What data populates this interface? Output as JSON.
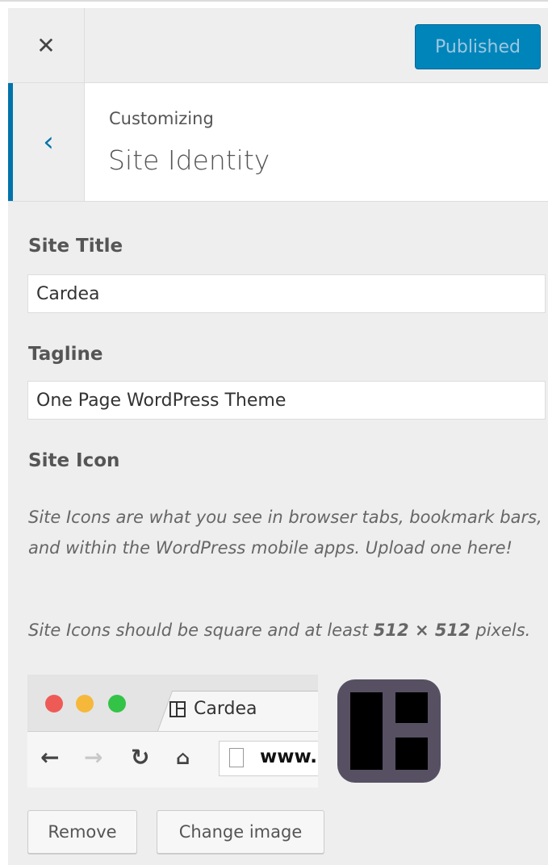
{
  "header": {
    "close_label": "✕",
    "publish_label": "Published"
  },
  "section": {
    "back_label": "‹",
    "subtitle": "Customizing",
    "title": "Site Identity"
  },
  "fields": {
    "site_title_label": "Site Title",
    "site_title_value": "Cardea",
    "tagline_label": "Tagline",
    "tagline_value": "One Page WordPress Theme"
  },
  "site_icon": {
    "label": "Site Icon",
    "description": "Site Icons are what you see in browser tabs, bookmark bars, and within the WordPress mobile apps. Upload one here!",
    "size_note_prefix": "Site Icons should be square and at least ",
    "size_note_value": "512 × 512",
    "size_note_suffix": " pixels.",
    "preview_tab_title": "Cardea",
    "preview_url": "www.",
    "remove_label": "Remove",
    "change_label": "Change image"
  },
  "colors": {
    "accent": "#0073aa",
    "publish_bg": "#0085ba",
    "icon_bg": "#575063"
  }
}
